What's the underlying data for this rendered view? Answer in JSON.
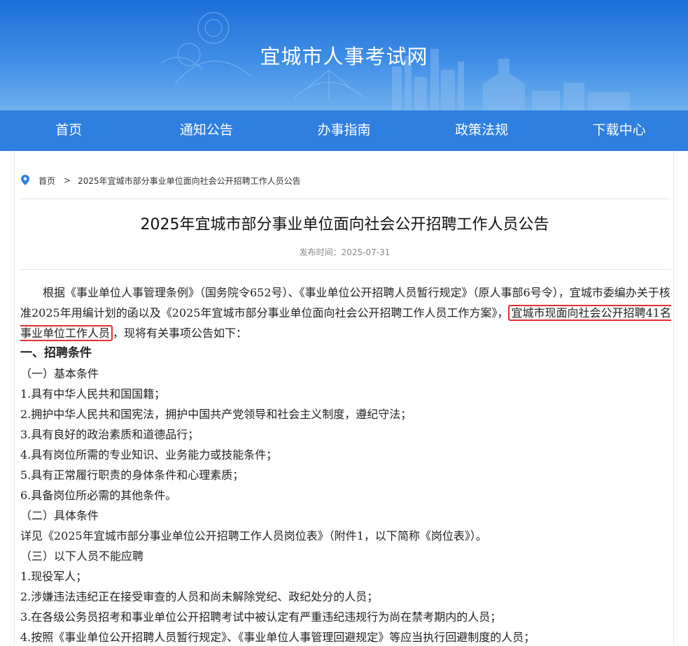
{
  "site": {
    "title": "宜城市人事考试网"
  },
  "nav": {
    "items": [
      "首页",
      "通知公告",
      "办事指南",
      "政策法规",
      "下载中心"
    ]
  },
  "breadcrumb": {
    "home": "首页",
    "separator": ">",
    "current": "2025年宜城市部分事业单位面向社会公开招聘工作人员公告"
  },
  "article": {
    "title": "2025年宜城市部分事业单位面向社会公开招聘工作人员公告",
    "date": "发布时间：2025-07-31",
    "intro_before": "根据《事业单位人事管理条例》（国务院令652号）、《事业单位公开招聘人员暂行规定》（原人事部6号令），宜城市委编办关于核准2025年用编计划的函以及《2025年宜城市部分事业单位面向社会公开招聘工作人员工作方案》，",
    "intro_highlight": "宜城市现面向社会公开招聘41名事业单位工作人员",
    "intro_after": "，现将有关事项公告如下：",
    "section1": "一、招聘条件",
    "sub1": "（一）基本条件",
    "basic": [
      "1.具有中华人民共和国国籍；",
      "2.拥护中华人民共和国宪法，拥护中国共产党领导和社会主义制度，遵纪守法；",
      "3.具有良好的政治素质和道德品行；",
      "4.具有岗位所需的专业知识、业务能力或技能条件；",
      "5.具有正常履行职责的身体条件和心理素质；",
      "6.具备岗位所必需的其他条件。"
    ],
    "sub2": "（二）具体条件",
    "specific": "详见《2025年宜城市部分事业单位公开招聘工作人员岗位表》（附件1，以下简称《岗位表》）。",
    "sub3": "（三）以下人员不能应聘",
    "excluded": [
      "1.现役军人；",
      "2.涉嫌违法违纪正在接受审查的人员和尚未解除党纪、政纪处分的人员；",
      "3.在各级公务员招考和事业单位公开招聘考试中被认定有严重违纪违规行为尚在禁考期内的人员；",
      "4.按照《事业单位公开招聘人员暂行规定》、《事业单位人事管理回避规定》等应当执行回避制度的人员；"
    ]
  },
  "colors": {
    "banner": "#1d6fd8",
    "nav": "#2e7fe0",
    "highlight_border": "#e23030"
  }
}
